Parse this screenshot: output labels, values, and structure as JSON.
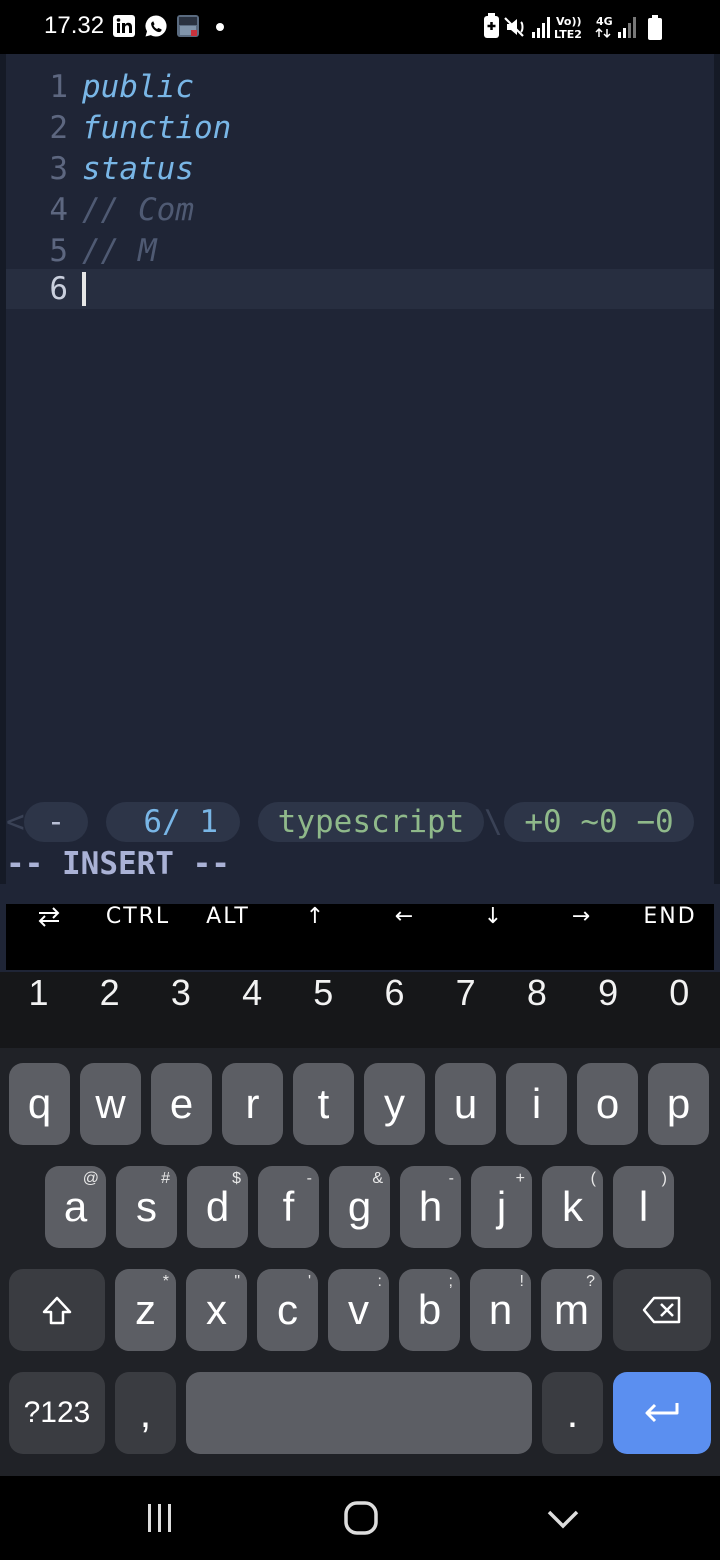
{
  "status_bar": {
    "time": "17.32",
    "notification_icons": [
      "linkedin-icon",
      "whatsapp-icon",
      "game-app-icon"
    ],
    "system_icons": [
      "battery-saver-icon",
      "mute-icon",
      "signal-icon",
      "volte-icon",
      "4g-icon",
      "signal-icon-2",
      "battery-icon"
    ],
    "volte_label": "Vo))",
    "lte_label": "LTE2",
    "net_label": "4G"
  },
  "editor": {
    "lines": [
      {
        "num": "1",
        "text": "public",
        "kind": "keyword"
      },
      {
        "num": "2",
        "text": "function",
        "kind": "keyword"
      },
      {
        "num": "3",
        "text": "status",
        "kind": "keyword"
      },
      {
        "num": "4",
        "text": "// Com",
        "kind": "comment"
      },
      {
        "num": "5",
        "text": "// M",
        "kind": "comment"
      },
      {
        "num": "6",
        "text": "",
        "kind": "current"
      }
    ],
    "statusline": {
      "left_marker": "<",
      "mode_indicator": "-",
      "position": "  6/ 1",
      "filetype": "typescript",
      "separator": "\\",
      "diff": "+0 ~0 −0"
    },
    "mode_text": "-- INSERT --"
  },
  "extra_keys": {
    "toggle_icon": "keyboard-switch-icon",
    "ctrl": "CTRL",
    "alt": "ALT",
    "up": "↑",
    "left": "←",
    "down": "↓",
    "right": "→",
    "end": "END"
  },
  "keyboard": {
    "numbers": [
      "1",
      "2",
      "3",
      "4",
      "5",
      "6",
      "7",
      "8",
      "9",
      "0"
    ],
    "row1": [
      "q",
      "w",
      "e",
      "r",
      "t",
      "y",
      "u",
      "i",
      "o",
      "p"
    ],
    "row2": [
      {
        "k": "a",
        "s": "@"
      },
      {
        "k": "s",
        "s": "#"
      },
      {
        "k": "d",
        "s": "$"
      },
      {
        "k": "f",
        "s": "-"
      },
      {
        "k": "g",
        "s": "&"
      },
      {
        "k": "h",
        "s": "-"
      },
      {
        "k": "j",
        "s": "+"
      },
      {
        "k": "k",
        "s": "("
      },
      {
        "k": "l",
        "s": ")"
      }
    ],
    "row3": [
      {
        "k": "z",
        "s": "*"
      },
      {
        "k": "x",
        "s": "\""
      },
      {
        "k": "c",
        "s": "'"
      },
      {
        "k": "v",
        "s": ":"
      },
      {
        "k": "b",
        "s": ";"
      },
      {
        "k": "n",
        "s": "!"
      },
      {
        "k": "m",
        "s": "?"
      }
    ],
    "symbols_key": "?123",
    "comma_key": ",",
    "period_key": ".",
    "shift_icon": "shift-icon",
    "backspace_icon": "backspace-icon",
    "enter_icon": "enter-icon"
  },
  "nav_bar": {
    "icons": [
      "recents-icon",
      "home-icon",
      "back-icon"
    ]
  },
  "colors": {
    "editor_bg": "#1f2536",
    "keyword": "#79b6e6",
    "comment": "#4f5a73",
    "enter_key": "#5b8ff0"
  }
}
